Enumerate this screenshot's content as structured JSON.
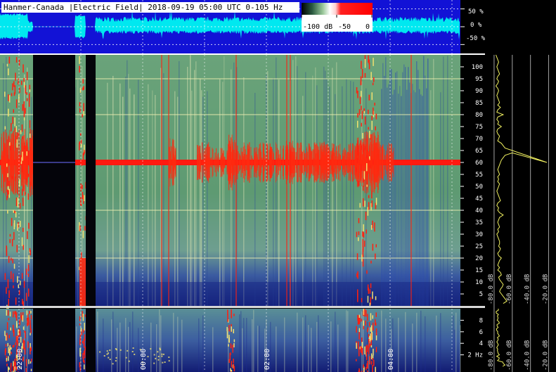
{
  "chart_data": [
    {
      "type": "line",
      "role": "waveform",
      "title": "Hanmer-Canada |Electric Field| 2018-09-19 05:00 UTC 0-105 Hz",
      "ylabel_ticks": [
        "50 %",
        "0 %",
        "-50 %"
      ],
      "ylim": [
        -75,
        75
      ],
      "colorbar": {
        "labels": [
          "-100 dB",
          "-50",
          "0"
        ],
        "range_db": [
          -100,
          0
        ]
      },
      "colors": {
        "background": "#1010d8",
        "trace": "#00e8f0"
      }
    },
    {
      "type": "heatmap",
      "role": "spectrogram",
      "y_unit": "Hz",
      "ylim": [
        0,
        105
      ],
      "ytick_labels": [
        "100",
        "95",
        "90",
        "85",
        "80",
        "75",
        "70",
        "65",
        "60",
        "55",
        "50",
        "45",
        "40",
        "35",
        "30",
        "25",
        "20",
        "15",
        "10",
        "5"
      ],
      "yticks": [
        100,
        95,
        90,
        85,
        80,
        75,
        70,
        65,
        60,
        55,
        50,
        45,
        40,
        35,
        30,
        25,
        20,
        15,
        10,
        5
      ],
      "strong_line_hz": 60,
      "harmonic_lines_hz": [
        20,
        40,
        80,
        95
      ],
      "colors": {
        "base": "#5a9a6a",
        "hot": "#ff1a10",
        "lowband": "#1a2a88",
        "gap": "#04040a"
      }
    },
    {
      "type": "heatmap",
      "role": "zoom-spectrogram",
      "y_unit": "Hz",
      "ylim": [
        0,
        10
      ],
      "ytick_labels": [
        "8",
        "6",
        "4",
        "2 Hz"
      ],
      "yticks": [
        8,
        6,
        4,
        2
      ],
      "x_ticks": [
        "22:00",
        "00:00",
        "02:00",
        "04:00"
      ]
    },
    {
      "type": "line",
      "role": "average-spectrum",
      "x_ticks": [
        "-80.0 dB",
        "-60.0 dB",
        "-40.0 dB",
        "-20.0 dB"
      ],
      "peak_hz": 60,
      "x": [
        -78,
        -77,
        -76,
        -75,
        -76,
        -77,
        -76,
        -75,
        -74,
        -76,
        -77,
        -75,
        -76,
        -78,
        -76,
        -75,
        -76,
        -77,
        -76,
        -75,
        -74,
        -76,
        -73,
        -76,
        -77,
        -70,
        -76,
        -77,
        -75,
        -76,
        -72,
        -76,
        -77,
        -76,
        -74,
        -75,
        -76,
        -72,
        -70,
        -68,
        -60,
        -22,
        -60,
        -68,
        -70,
        -72,
        -74,
        -75,
        -76,
        -75,
        -74,
        -76,
        -75,
        -76,
        -74,
        -75,
        -76,
        -77,
        -76,
        -75,
        -74,
        -73,
        -76,
        -77,
        -75,
        -76,
        -74,
        -70,
        -74,
        -75,
        -76,
        -75,
        -74,
        -76,
        -75,
        -77,
        -76,
        -75,
        -74,
        -74,
        -75,
        -73,
        -74,
        -76,
        -75,
        -72,
        -74,
        -75,
        -76,
        -74,
        -76,
        -73,
        -72,
        -75,
        -74,
        -72,
        -70,
        -71,
        -73,
        -74,
        -72,
        -70,
        -68,
        -66,
        -70
      ],
      "y": [
        105,
        104,
        103,
        102,
        101,
        100,
        99,
        98,
        97,
        96,
        95,
        94,
        93,
        92,
        91,
        90,
        89,
        88,
        87,
        86,
        85,
        84,
        83,
        82,
        81,
        80,
        79,
        78,
        77,
        76,
        75,
        74,
        73,
        72,
        71,
        70,
        69,
        68,
        67,
        66,
        65,
        60,
        64,
        63,
        62,
        61,
        59,
        58,
        57,
        56,
        55,
        54,
        53,
        52,
        51,
        50,
        49,
        48,
        47,
        46,
        45,
        44,
        43,
        42,
        41,
        40,
        39,
        38,
        37,
        36,
        35,
        34,
        33,
        32,
        31,
        30,
        29,
        28,
        27,
        26,
        25,
        24,
        23,
        22,
        21,
        20,
        19,
        18,
        17,
        16,
        15,
        14,
        13,
        12,
        11,
        10,
        9,
        8,
        7,
        6,
        5,
        4,
        3,
        2,
        1
      ]
    }
  ]
}
